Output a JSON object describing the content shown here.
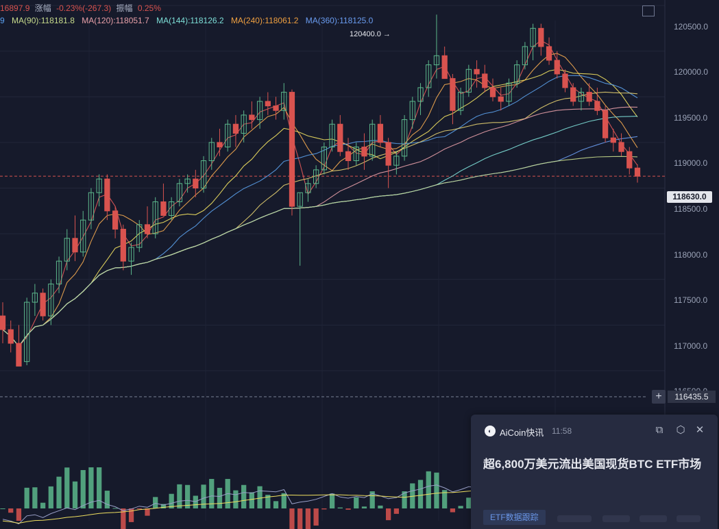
{
  "header": {
    "price_fragment": "16897.9",
    "change_label": "涨幅",
    "change_value": "-0.23%(-267.3)",
    "amplitude_label": "振幅",
    "amplitude_value": "0.25%"
  },
  "ma_legend": [
    {
      "label": "9",
      "color": "#5aa0f0"
    },
    {
      "label": "MA(90):118181.8",
      "color": "#c8dc8c"
    },
    {
      "label": "MA(120):118051.7",
      "color": "#e8a0a8"
    },
    {
      "label": "MA(144):118126.2",
      "color": "#7ee0d8"
    },
    {
      "label": "MA(240):118061.2",
      "color": "#f0a040"
    },
    {
      "label": "MA(360):118125.0",
      "color": "#6a9cf0"
    }
  ],
  "y_axis_labels": [
    "120500.0",
    "120000.0",
    "119500.0",
    "119000.0",
    "118500.0",
    "118000.0",
    "117500.0",
    "117000.0",
    "116500.0"
  ],
  "current_price": "118630.0",
  "crosshair_price": "116435.5",
  "peak_label": "120400.0 →",
  "colors": {
    "up": "#5cb88c",
    "down": "#d9534f",
    "bg": "#161a2b"
  },
  "news_card": {
    "source": "AiCoin快讯",
    "time": "11:58",
    "headline": "超6,800万美元流出美国现货BTC ETF市场",
    "tag": "ETF数据跟踪",
    "icons": [
      "external-link-icon",
      "settings-icon",
      "close-icon"
    ]
  },
  "chart_data": {
    "type": "candlestick",
    "ylim": [
      116400,
      120600
    ],
    "y_ticks": [
      116500,
      117000,
      117500,
      118000,
      118500,
      119000,
      119500,
      120000,
      120500
    ],
    "candles": [
      [
        117100,
        117250,
        116800,
        116950
      ],
      [
        116950,
        117050,
        116700,
        116800
      ],
      [
        116800,
        117000,
        116550,
        116550
      ],
      [
        116600,
        117300,
        116560,
        117250
      ],
      [
        117250,
        117450,
        117100,
        117350
      ],
      [
        117350,
        117400,
        117050,
        117100
      ],
      [
        117100,
        117500,
        117000,
        117450
      ],
      [
        117450,
        117750,
        117350,
        117700
      ],
      [
        117700,
        118050,
        117600,
        117950
      ],
      [
        117950,
        118200,
        117700,
        117800
      ],
      [
        117800,
        118250,
        117750,
        118150
      ],
      [
        118150,
        118500,
        118050,
        118450
      ],
      [
        118450,
        118650,
        118300,
        118600
      ],
      [
        118600,
        118650,
        118150,
        118250
      ],
      [
        118250,
        118300,
        117950,
        118050
      ],
      [
        118050,
        118100,
        117600,
        117700
      ],
      [
        117700,
        117900,
        117550,
        117850
      ],
      [
        117850,
        118150,
        117800,
        118100
      ],
      [
        118100,
        118300,
        117950,
        118000
      ],
      [
        118000,
        118400,
        117950,
        118350
      ],
      [
        118350,
        118550,
        118250,
        118200
      ],
      [
        118200,
        118400,
        118150,
        118350
      ],
      [
        118350,
        118600,
        118300,
        118550
      ],
      [
        118550,
        118650,
        118450,
        118600
      ],
      [
        118600,
        118700,
        118400,
        118500
      ],
      [
        118500,
        118850,
        118450,
        118800
      ],
      [
        118800,
        119050,
        118700,
        119000
      ],
      [
        119000,
        119150,
        118850,
        118950
      ],
      [
        118950,
        119250,
        118900,
        119200
      ],
      [
        119200,
        119300,
        118950,
        119100
      ],
      [
        119100,
        119350,
        119000,
        119300
      ],
      [
        119300,
        119450,
        119150,
        119250
      ],
      [
        119250,
        119500,
        119150,
        119450
      ],
      [
        119450,
        119550,
        119300,
        119400
      ],
      [
        119400,
        119500,
        119250,
        119350
      ],
      [
        119350,
        119650,
        119250,
        119550
      ],
      [
        119550,
        119580,
        118200,
        118300
      ],
      [
        118300,
        118450,
        117650,
        118450
      ],
      [
        118450,
        118600,
        118350,
        118550
      ],
      [
        118550,
        118750,
        118500,
        118700
      ],
      [
        118700,
        119000,
        118650,
        118950
      ],
      [
        118950,
        119250,
        118900,
        119200
      ],
      [
        119200,
        119300,
        118850,
        118900
      ],
      [
        118900,
        119050,
        118700,
        118800
      ],
      [
        118800,
        119000,
        118750,
        118950
      ],
      [
        118950,
        119100,
        118700,
        118850
      ],
      [
        118850,
        119250,
        118800,
        119200
      ],
      [
        119200,
        119300,
        118950,
        119000
      ],
      [
        119000,
        119050,
        118500,
        118750
      ],
      [
        118750,
        118900,
        118650,
        118850
      ],
      [
        118850,
        119300,
        118800,
        119250
      ],
      [
        119250,
        119500,
        119150,
        119450
      ],
      [
        119450,
        119650,
        119300,
        119600
      ],
      [
        119600,
        119900,
        119500,
        119850
      ],
      [
        119850,
        120400,
        119700,
        119950
      ],
      [
        119950,
        120050,
        119700,
        119700
      ],
      [
        119700,
        119750,
        119200,
        119350
      ],
      [
        119350,
        119600,
        119300,
        119550
      ],
      [
        119550,
        119850,
        119500,
        119800
      ],
      [
        119800,
        119900,
        119600,
        119750
      ],
      [
        119750,
        119850,
        119550,
        119600
      ],
      [
        119600,
        119700,
        119450,
        119500
      ],
      [
        119500,
        119600,
        119350,
        119450
      ],
      [
        119450,
        119700,
        119400,
        119650
      ],
      [
        119650,
        119900,
        119600,
        119850
      ],
      [
        119850,
        120100,
        119800,
        120050
      ],
      [
        120050,
        120300,
        119900,
        120250
      ],
      [
        120250,
        120300,
        119950,
        120050
      ],
      [
        120050,
        120150,
        119850,
        119900
      ],
      [
        119900,
        120000,
        119700,
        119750
      ],
      [
        119750,
        119800,
        119550,
        119600
      ],
      [
        119600,
        119650,
        119400,
        119450
      ],
      [
        119450,
        119600,
        119350,
        119550
      ],
      [
        119550,
        119650,
        119400,
        119450
      ],
      [
        119450,
        119600,
        119300,
        119350
      ],
      [
        119350,
        119400,
        119000,
        119050
      ],
      [
        119050,
        119150,
        118900,
        119000
      ],
      [
        119000,
        119100,
        118850,
        118900
      ],
      [
        118900,
        118950,
        118650,
        118720
      ],
      [
        118720,
        118760,
        118560,
        118630
      ]
    ],
    "ma_series": [
      {
        "color": "#e45a5a"
      },
      {
        "color": "#f2a850"
      },
      {
        "color": "#f0e060"
      },
      {
        "color": "#5a9fe8"
      },
      {
        "color": "#e4d070"
      },
      {
        "color": "#e8a0a8"
      },
      {
        "color": "#7ee0d8"
      },
      {
        "color": "#6a9cf0"
      },
      {
        "color": "#c8dc8c"
      }
    ]
  }
}
